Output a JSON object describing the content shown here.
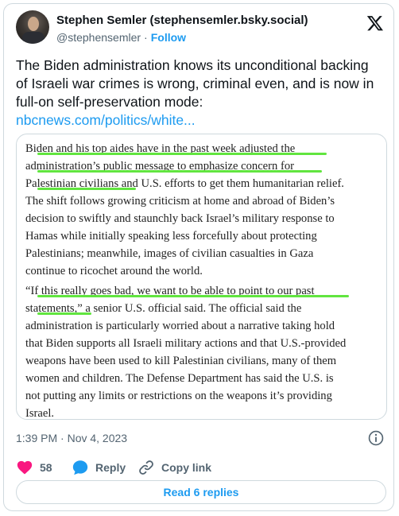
{
  "author": {
    "name": "Stephen Semler (stephensemler.bsky.social)",
    "handle": "@stephensemler",
    "separator": "·",
    "follow_label": "Follow"
  },
  "tweet": {
    "text_lines": [
      "The Biden administration knows its unconditional backing",
      "of Israeli war crimes is wrong, criminal even, and is now in",
      "full-on self-preservation mode:"
    ],
    "link_text": "nbcnews.com/politics/white..."
  },
  "article_excerpt": {
    "paragraph_1": [
      "Biden and his top aides have in the past week adjusted the",
      "administration’s public message to emphasize concern for",
      "Palestinian civilians and U.S. efforts to get them humanitarian relief.",
      "The shift follows growing criticism at home and abroad of Biden’s",
      "decision to swiftly and staunchly back Israel’s military response to",
      "Hamas while initially speaking less forcefully about protecting",
      "Palestinians; meanwhile, images of civilian casualties in Gaza",
      "continue to ricochet around the world."
    ],
    "paragraph_2": [
      "“If this really goes bad, we want to be able to point to our past",
      "statements,” a senior U.S. official said. The official said the",
      "administration is particularly worried about a narrative taking hold",
      "that Biden supports all Israeli military actions and that U.S.-provided",
      "weapons have been used to kill Palestinian civilians, many of them",
      "women and children. The Defense Department has said the U.S. is",
      "not putting any limits or restrictions on the weapons it’s providing",
      "Israel."
    ],
    "highlight_color": "#61e53f"
  },
  "meta": {
    "timestamp": "1:39 PM · Nov 4, 2023"
  },
  "actions": {
    "like_count": "58",
    "reply_label": "Reply",
    "copy_link_label": "Copy link",
    "read_replies_label": "Read 6 replies"
  },
  "colors": {
    "accent": "#1d9bf0",
    "like": "#f91880",
    "secondary_text": "#536471",
    "border": "#cfd9de"
  },
  "icons": [
    "x-logo-icon",
    "info-icon",
    "heart-icon",
    "reply-bubble-icon",
    "link-icon"
  ]
}
